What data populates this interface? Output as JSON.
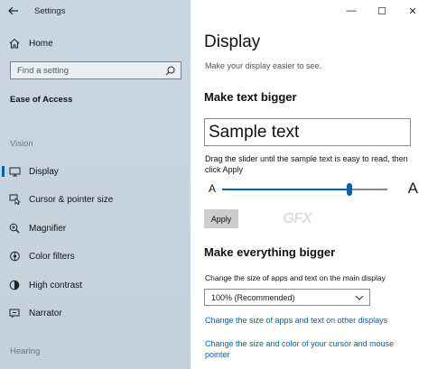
{
  "window": {
    "title": "Settings",
    "controls": [
      "—",
      "☐",
      "✕"
    ]
  },
  "sidebar": {
    "home_label": "Home",
    "search_placeholder": "Find a setting",
    "category": "Ease of Access",
    "group_vision": "Vision",
    "group_hearing": "Hearing",
    "items": [
      {
        "label": "Display",
        "icon": "display-icon",
        "selected": true
      },
      {
        "label": "Cursor & pointer size",
        "icon": "cursor-icon",
        "selected": false
      },
      {
        "label": "Magnifier",
        "icon": "magnifier-icon",
        "selected": false
      },
      {
        "label": "Color filters",
        "icon": "color-filter-icon",
        "selected": false
      },
      {
        "label": "High contrast",
        "icon": "high-contrast-icon",
        "selected": false
      },
      {
        "label": "Narrator",
        "icon": "narrator-icon",
        "selected": false
      }
    ]
  },
  "main": {
    "title": "Display",
    "subtitle": "Make your display easier to see.",
    "text_section": {
      "heading": "Make text bigger",
      "sample": "Sample text",
      "hint": "Drag the slider until the sample text is easy to read, then click Apply",
      "slider_min_label": "A",
      "slider_max_label": "A",
      "slider_value": 0.77,
      "apply_label": "Apply"
    },
    "watermark": "GFX",
    "everything_section": {
      "heading": "Make everything bigger",
      "field_label": "Change the size of apps and text on the main display",
      "dropdown_value": "100% (Recommended)",
      "link_other_displays": "Change the size of apps and text on other displays",
      "link_cursor": "Change the size and color of your cursor and mouse pointer"
    }
  },
  "colors": {
    "accent": "#0063b1",
    "sidebar_bg": "#c9d6e2",
    "link": "#0063b1"
  }
}
